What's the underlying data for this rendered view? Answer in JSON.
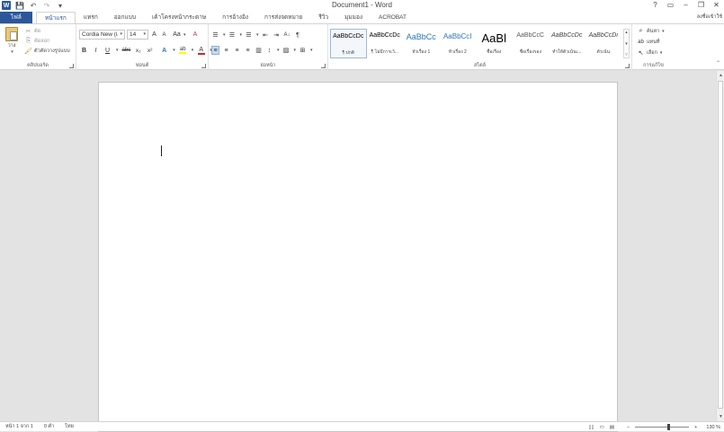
{
  "window": {
    "title": "Document1 - Word",
    "help": "?",
    "ribbon_display": "▭",
    "minimize": "–",
    "restore": "❐",
    "close": "✕",
    "sign_in": "ลงชื่อเข้าใช้"
  },
  "qat": {
    "save": "💾",
    "undo": "↶",
    "redo": "↷",
    "customize": "▾"
  },
  "tabs": {
    "file": "ไฟล์",
    "home": "หน้าแรก",
    "insert": "แทรก",
    "design": "ออกแบบ",
    "layout": "เค้าโครงหน้ากระดาษ",
    "references": "การอ้างอิง",
    "mailings": "การส่งจดหมาย",
    "review": "รีวิว",
    "view": "มุมมอง",
    "acrobat": "ACROBAT"
  },
  "clipboard": {
    "label": "คลิปบอร์ด",
    "paste": "วาง",
    "cut": "ตัด",
    "copy": "คัดลอก",
    "format_painter": "ตัวคัดวางรูปแบบ"
  },
  "font": {
    "label": "ฟอนต์",
    "font_name": "Cordia New (เ",
    "font_size": "14",
    "grow": "A",
    "shrink": "A",
    "change_case": "Aa",
    "clear": "A",
    "bold": "B",
    "italic": "I",
    "underline": "U",
    "strikethrough": "abc",
    "subscript": "x₂",
    "superscript": "x²",
    "text_effects": "A",
    "highlight": "ab",
    "font_color": "A",
    "highlight_color": "#ffff00",
    "font_color_value": "#e02020"
  },
  "paragraph": {
    "label": "ย่อหน้า",
    "bullets": "☰",
    "numbering": "☰",
    "multilevel": "☰",
    "decrease_indent": "⇤",
    "increase_indent": "⇥",
    "sort": "A↓",
    "show_marks": "¶",
    "align_left": "≡",
    "center": "≡",
    "align_right": "≡",
    "justify": "≡",
    "columns": "▥",
    "line_spacing": "↕",
    "shading": "▨",
    "borders": "⊞"
  },
  "styles": {
    "label": "สไตล์",
    "items": [
      {
        "preview": "AaBbCcDc",
        "name": "¶ ปกติ",
        "color": "#000000"
      },
      {
        "preview": "AaBbCcDc",
        "name": "¶ ไม่มีการเว้...",
        "color": "#000000"
      },
      {
        "preview": "AaBbCc",
        "name": "หัวเรื่อง 1",
        "color": "#2e74b5"
      },
      {
        "preview": "AaBbCcI",
        "name": "หัวเรื่อง 2",
        "color": "#2e74b5"
      },
      {
        "preview": "AaBl",
        "name": "ชื่อเรื่อง",
        "color": "#000000"
      },
      {
        "preview": "AaBbCcC",
        "name": "ชื่อเรื่องรอง",
        "color": "#595959"
      },
      {
        "preview": "AaBbCcDc",
        "name": "ทำให้ตัวเน้นเ...",
        "color": "#404040"
      },
      {
        "preview": "AaBbCcDi",
        "name": "ตัวเน้น",
        "color": "#404040"
      }
    ]
  },
  "editing": {
    "label": "การแก้ไข",
    "find": "ค้นหา",
    "replace": "แทนที่",
    "select": "เลือก"
  },
  "statusbar": {
    "page": "หน้า 1 จาก 1",
    "words": "0 คำ",
    "language": "ไทย",
    "zoom": "130 %",
    "zoom_minus": "−",
    "zoom_plus": "+"
  }
}
